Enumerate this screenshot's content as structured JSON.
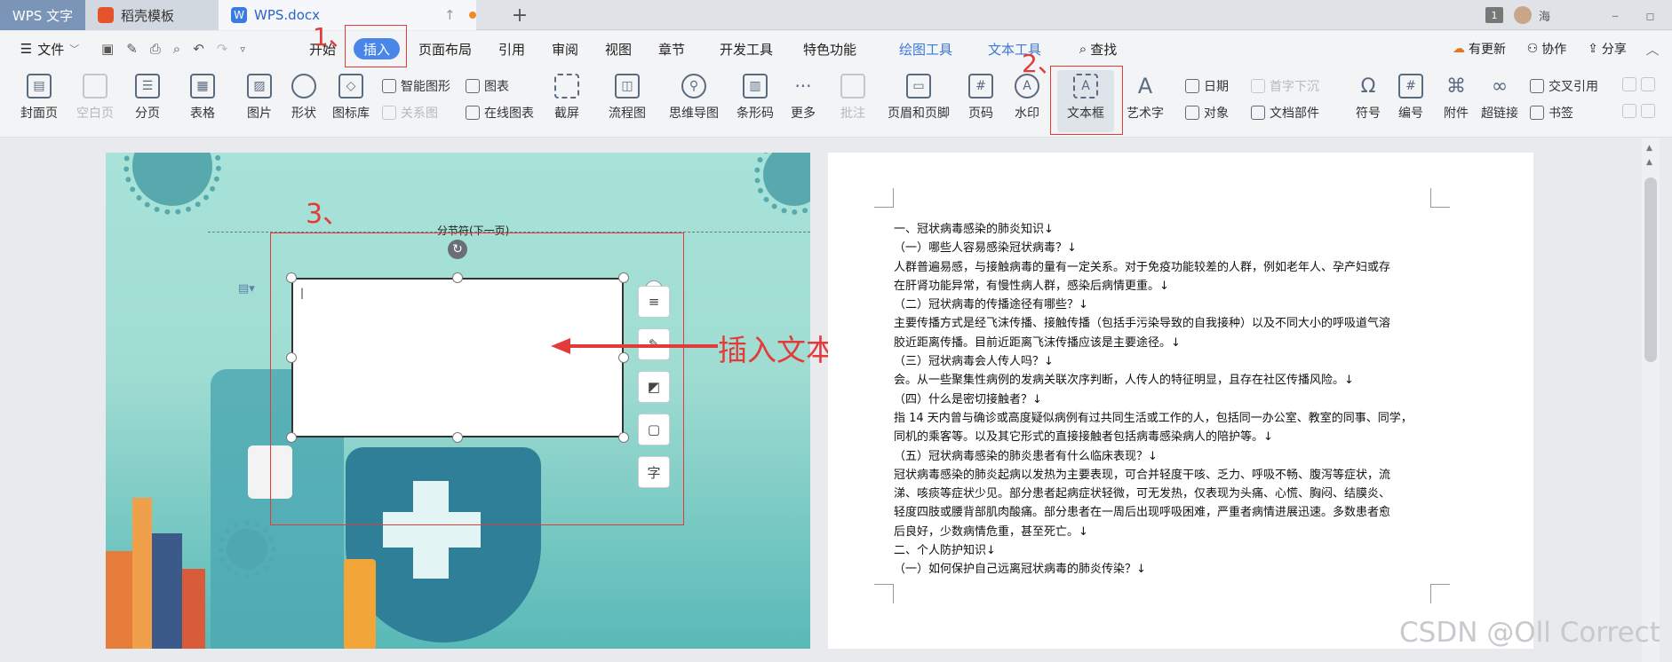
{
  "tabs": {
    "wps": "WPS 文字",
    "template": "稻壳模板",
    "doc": "WPS.docx",
    "user": "海"
  },
  "menu": {
    "file": "文件",
    "items": [
      "开始",
      "插入",
      "页面布局",
      "引用",
      "审阅",
      "视图",
      "章节",
      "开发工具",
      "特色功能",
      "绘图工具",
      "文本工具",
      "查找"
    ],
    "right": [
      "有更新",
      "协作",
      "分享"
    ]
  },
  "ribbon": {
    "big": [
      "封面页",
      "空白页",
      "分页",
      "表格",
      "图片",
      "形状",
      "图标库",
      "截屏",
      "流程图",
      "思维导图",
      "条形码",
      "更多",
      "批注",
      "页眉和页脚",
      "页码",
      "水印",
      "文本框",
      "艺术字",
      "符号",
      "编号",
      "附件",
      "超链接"
    ],
    "small": [
      "智能图形",
      "图表",
      "关系图",
      "在线图表",
      "日期",
      "首字下沉",
      "对象",
      "文档部件",
      "交叉引用",
      "书签"
    ]
  },
  "annotations": {
    "step1": "1、",
    "step2": "2、",
    "step3": "3、",
    "arrow_label": "插入文本框"
  },
  "section_break": "分节符(下一页)",
  "textbox_tools": [
    "≡",
    "✎",
    "◩",
    "▢",
    "字"
  ],
  "document": {
    "lines": [
      "一、冠状病毒感染的肺炎知识↓",
      "（一）哪些人容易感染冠状病毒？↓",
      "人群普遍易感，与接触病毒的量有一定关系。对于免疫功能较差的人群，例如老年人、孕产妇或存",
      "在肝肾功能异常，有慢性病人群，感染后病情更重。↓",
      "（二）冠状病毒的传播途径有哪些？↓",
      "主要传播方式是经飞沫传播、接触传播（包括手污染导致的自我接种）以及不同大小的呼吸道气溶",
      "胶近距离传播。目前近距离飞沫传播应该是主要途径。↓",
      "（三）冠状病毒会人传人吗？↓",
      "会。从一些聚集性病例的发病关联次序判断，人传人的特征明显，且存在社区传播风险。↓",
      "（四）什么是密切接触者？↓",
      "指 14 天内曾与确诊或高度疑似病例有过共同生活或工作的人，包括同一办公室、教室的同事、同学，",
      "同机的乘客等。以及其它形式的直接接触者包括病毒感染病人的陪护等。↓",
      "（五）冠状病毒感染的肺炎患者有什么临床表现？↓",
      "冠状病毒感染的肺炎起病以发热为主要表现，可合并轻度干咳、乏力、呼吸不畅、腹泻等症状，流",
      "涕、咳痰等症状少见。部分患者起病症状轻微，可无发热，仅表现为头痛、心慌、胸闷、结膜炎、",
      "轻度四肢或腰背部肌肉酸痛。部分患者在一周后出现呼吸困难，严重者病情进展迅速。多数患者愈",
      "后良好，少数病情危重，甚至死亡。↓",
      "二、个人防护知识↓",
      "（一）如何保护自己远离冠状病毒的肺炎传染？↓"
    ]
  },
  "watermark": "CSDN @Oll Correct",
  "colors": {
    "accent": "#4a86e8",
    "annotation": "#e33a3a",
    "tool_blue": "#3b78d8"
  }
}
